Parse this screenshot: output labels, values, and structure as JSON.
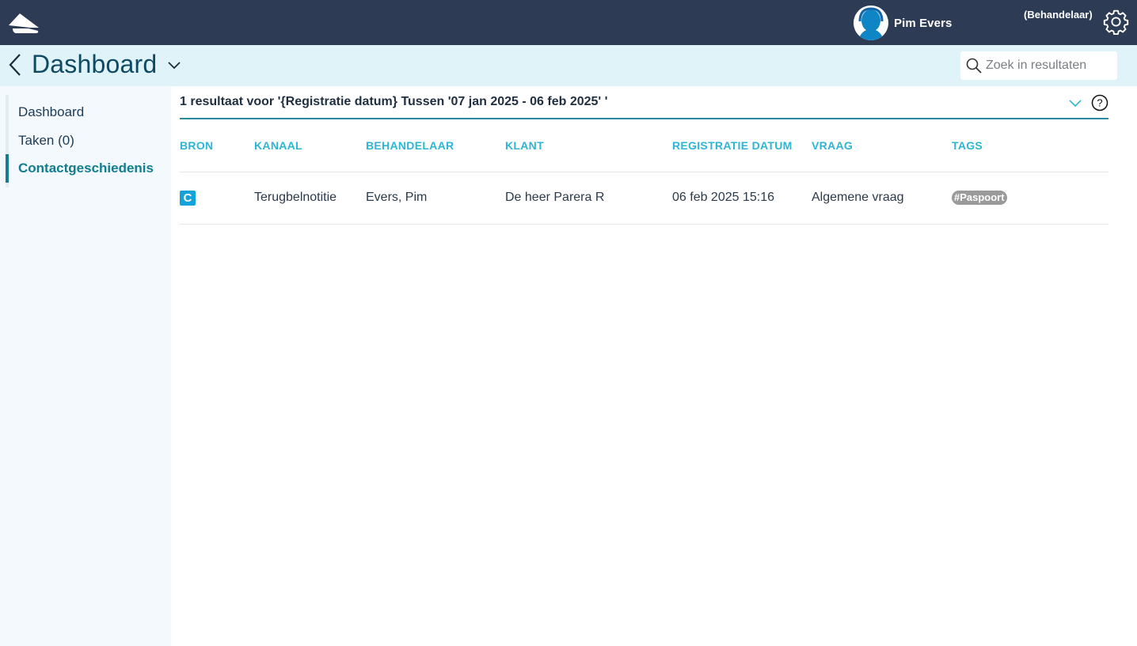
{
  "topbar": {
    "user_name": "Pim Evers",
    "role": "(Behandelaar)"
  },
  "header": {
    "title": "Dashboard",
    "search_placeholder": "Zoek in resultaten"
  },
  "sidebar": {
    "items": [
      {
        "label": "Dashboard"
      },
      {
        "label": "Taken (0)"
      },
      {
        "label": "Contactgeschiedenis"
      }
    ]
  },
  "results": {
    "summary": "1 resultaat voor '{Registratie datum} Tussen '07 jan 2025 - 06 feb 2025' '",
    "columns": [
      "BRON",
      "KANAAL",
      "BEHANDELAAR",
      "KLANT",
      "REGISTRATIE DATUM",
      "VRAAG",
      "TAGS"
    ],
    "rows": [
      {
        "bron": "C",
        "kanaal": "Terugbelnotitie",
        "behandelaar": "Evers, Pim",
        "klant": "De heer Parera R",
        "registratie_datum": "06 feb 2025 15:16",
        "vraag": "Algemene vraag",
        "tag": "#Paspoort"
      }
    ]
  },
  "colors": {
    "topbar": "#2d3c54",
    "subheader": "#dff3f8",
    "accent": "#2db6d4",
    "active": "#117d8f"
  }
}
